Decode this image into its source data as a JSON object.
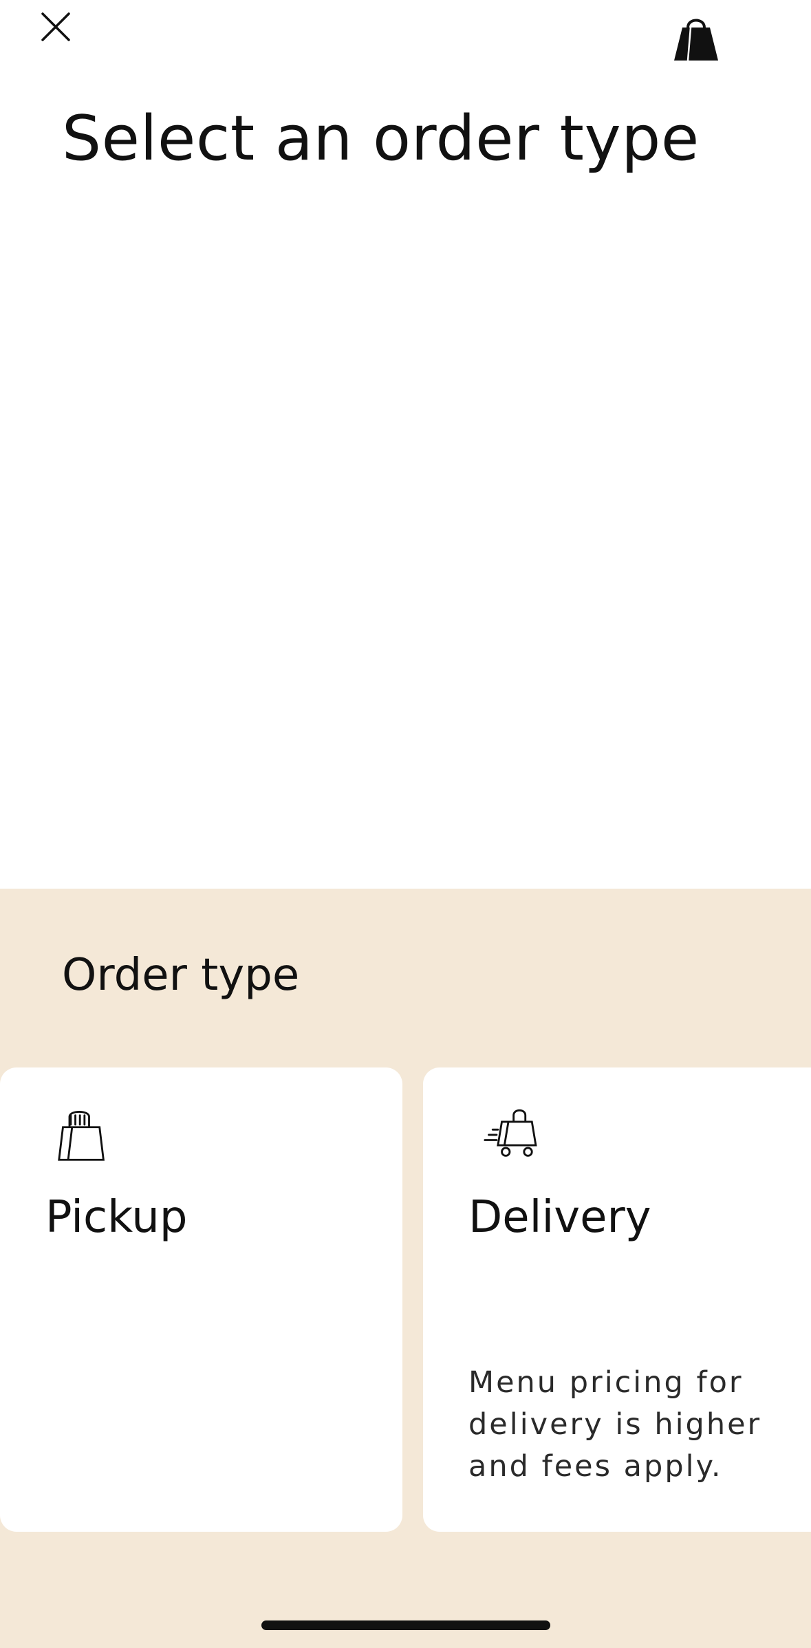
{
  "header": {
    "title": "Select an order type",
    "close_icon": "close-icon",
    "bag_icon": "shopping-bag-icon"
  },
  "order_type": {
    "section_title": "Order type",
    "options": [
      {
        "label": "Pickup",
        "icon": "pickup-bag-hand-icon",
        "note": ""
      },
      {
        "label": "Delivery",
        "icon": "delivery-cart-icon",
        "note": "Menu pricing for delivery is higher and fees apply."
      }
    ]
  },
  "colors": {
    "page_background": "#ffffff",
    "panel_background": "#f4e8d7",
    "card_background": "#ffffff",
    "text": "#111111"
  }
}
